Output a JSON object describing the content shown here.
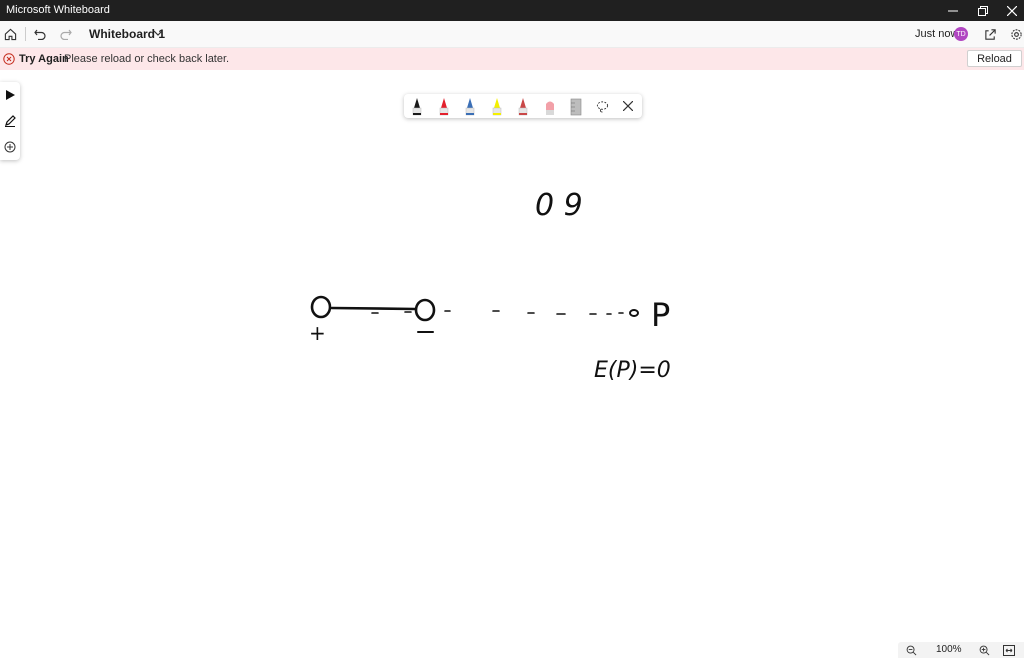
{
  "window": {
    "title": "Microsoft Whiteboard"
  },
  "header": {
    "board_title": "Whiteboard 1",
    "saved_status": "Just now",
    "avatar_initials": "TD"
  },
  "banner": {
    "title": "Try Again",
    "message": "Please reload or check back later.",
    "reload_label": "Reload",
    "color": "#fde7e9"
  },
  "pen_tray": {
    "pens": [
      {
        "name": "black-pen",
        "color": "#1a1a1a"
      },
      {
        "name": "red-pen",
        "color": "#e3202c"
      },
      {
        "name": "blue-pen",
        "color": "#3b6fb6"
      },
      {
        "name": "highlighter",
        "color": "#f4f000"
      },
      {
        "name": "red-tip-pen",
        "color": "#c94848"
      },
      {
        "name": "eraser",
        "color": "#f2a0a8"
      },
      {
        "name": "ruler",
        "color": "#bdbdbd"
      }
    ]
  },
  "canvas": {
    "annotation_top": "0 9",
    "equation": "E(P)=0",
    "charge_positive": "+",
    "charge_negative": "-",
    "point_label": "P"
  },
  "zoom": {
    "level": "100%"
  }
}
